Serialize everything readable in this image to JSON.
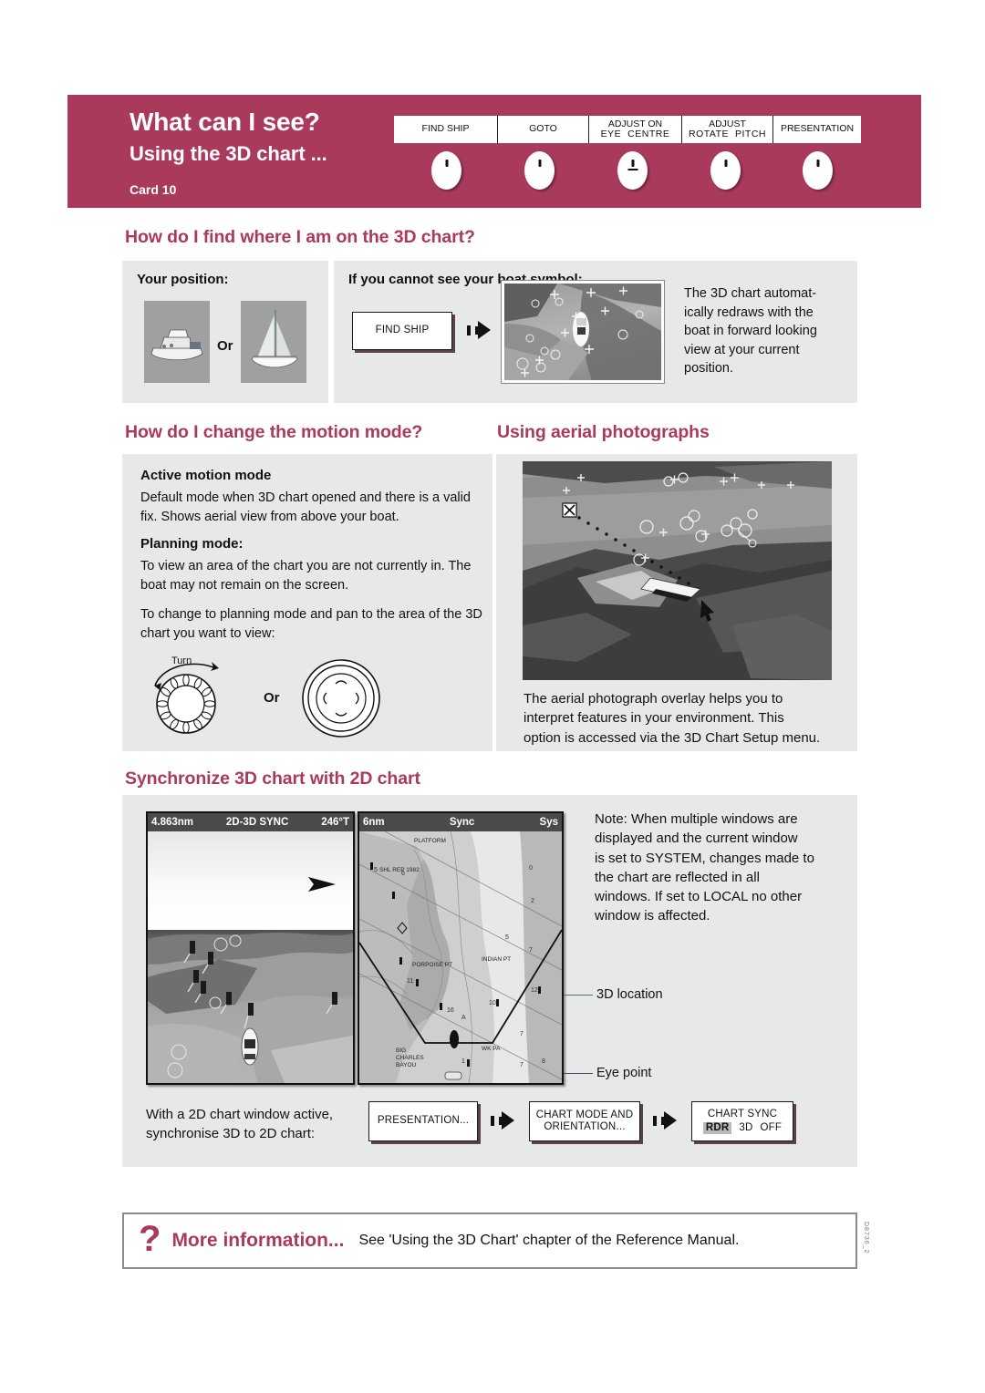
{
  "header": {
    "title": "What can I see?",
    "subtitle": "Using the 3D chart ...",
    "card": "Card 10",
    "accent_color": "#AA3A5C",
    "keys": [
      {
        "line1": "FIND SHIP",
        "line2a": "",
        "line2b": "",
        "underline": false
      },
      {
        "line1": "GOTO",
        "line2a": "",
        "line2b": "",
        "underline": false
      },
      {
        "line1": "ADJUST ON",
        "line2a": "EYE",
        "line2b": "CENTRE",
        "underline": true
      },
      {
        "line1": "ADJUST",
        "line2a": "ROTATE",
        "line2b": "PITCH",
        "underline": false
      },
      {
        "line1": "PRESENTATION",
        "line2a": "",
        "line2b": "",
        "underline": false
      }
    ]
  },
  "section_find": {
    "heading": "How do I find where I am on the 3D chart?",
    "your_position_label": "Your position:",
    "or_label": "Or",
    "cannot_see_label": "If you cannot see your boat symbol:",
    "find_ship_button": "FIND SHIP",
    "result_text": "The 3D chart automatically redraws with the boat in forward looking view at your current position.",
    "result_lines": [
      "The 3D chart automat-",
      "ically redraws with the",
      "boat in forward looking",
      "view at your current",
      "position."
    ]
  },
  "section_motion": {
    "heading": "How do I change the motion mode?",
    "active_title": "Active motion mode",
    "active_body": "Default mode when 3D chart opened and there is a valid fix.  Shows aerial view from above your boat.",
    "planning_title": "Planning mode:",
    "planning_body": "To view an area of the chart you are not currently in. The boat may not remain on the screen.",
    "change_body": "To change to planning mode and pan to the area of the 3D chart you want to view:",
    "turn_label": "Turn",
    "or_label": "Or"
  },
  "section_aerial": {
    "heading": "Using aerial photographs",
    "caption": "The aerial photograph overlay helps you to interpret features in your environment. This option is accessed via the 3D Chart Setup menu.",
    "caption_lines": [
      "The aerial photograph overlay helps you to",
      "interpret features in your environment. This",
      "option is accessed via the 3D Chart Setup menu."
    ]
  },
  "section_sync": {
    "heading": "Synchronize 3D chart with 2D chart",
    "left_screen": {
      "range": "4.863nm",
      "mode": "2D-3D SYNC",
      "heading_value": "246°T"
    },
    "right_screen": {
      "range": "6nm",
      "sync": "Sync",
      "sys": "Sys",
      "labels": [
        "PLATFORM",
        "SHL REP 1982",
        "PORPOISE PT",
        "INDIAN PT",
        "BIG CHARLES BAYOU",
        "WK PA"
      ],
      "soundings": [
        "5",
        "6",
        "7",
        "8",
        "5",
        "7",
        "7",
        "2",
        "11",
        "10",
        "12",
        "1",
        "7",
        "8"
      ]
    },
    "note_text": "Note: When multiple windows are displayed and the current window is set to SYSTEM, changes made to the chart are reflected in all windows.  If set to LOCAL no other window is affected.",
    "note_lines": [
      "Note: When multiple windows are",
      "displayed and the current window",
      "is set to SYSTEM, changes made to",
      "the chart are reflected in all",
      "windows.  If set to LOCAL no other",
      "window is affected."
    ],
    "callout_3d": "3D location",
    "callout_eye": "Eye point",
    "instruction_lines": [
      "With a 2D chart window active,",
      "synchronise 3D to 2D chart:"
    ],
    "steps": [
      {
        "label": "PRESENTATION...",
        "lines": [
          "PRESENTATION..."
        ]
      },
      {
        "label": "CHART MODE AND ORIENTATION...",
        "lines": [
          "CHART MODE AND",
          "ORIENTATION..."
        ]
      },
      {
        "label": "CHART SYNC",
        "lines": [
          "CHART SYNC"
        ],
        "options": [
          "RDR",
          "3D",
          "OFF"
        ],
        "selected": "RDR"
      }
    ]
  },
  "footer": {
    "icon": "question-mark",
    "title": "More information...",
    "text": "See 'Using the 3D Chart' chapter of the Reference Manual.",
    "doc_code": "D8736_2"
  }
}
